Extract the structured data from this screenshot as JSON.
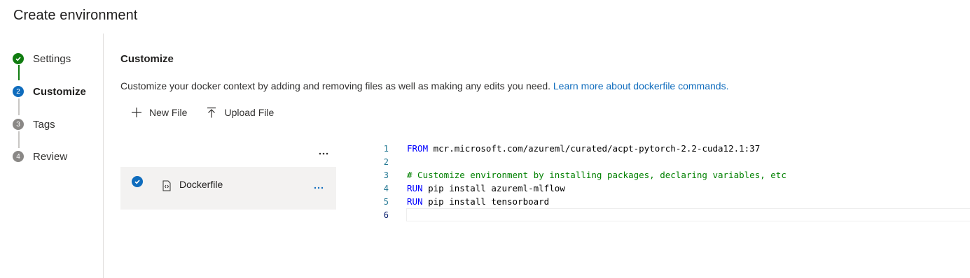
{
  "page": {
    "title": "Create environment"
  },
  "stepper": {
    "steps": [
      {
        "number": "",
        "label": "Settings",
        "state": "completed"
      },
      {
        "number": "2",
        "label": "Customize",
        "state": "active"
      },
      {
        "number": "3",
        "label": "Tags",
        "state": "pending"
      },
      {
        "number": "4",
        "label": "Review",
        "state": "pending"
      }
    ]
  },
  "main": {
    "title": "Customize",
    "description": "Customize your docker context by adding and removing files as well as making any edits you need.",
    "learn_more_link": "Learn more about dockerfile commands.",
    "toolbar": {
      "new_file_label": "New File",
      "upload_file_label": "Upload File"
    },
    "file_panel": {
      "more_label": "...",
      "files": [
        {
          "name": "Dockerfile",
          "selected": true,
          "more_label": "..."
        }
      ]
    }
  },
  "editor": {
    "lines": [
      {
        "number": "1",
        "keyword": "FROM",
        "rest": " mcr.microsoft.com/azureml/curated/acpt-pytorch-2.2-cuda12.1:37",
        "comment": ""
      },
      {
        "number": "2",
        "keyword": "",
        "rest": "",
        "comment": ""
      },
      {
        "number": "3",
        "keyword": "",
        "rest": "",
        "comment": "# Customize environment by installing packages, declaring variables, etc"
      },
      {
        "number": "4",
        "keyword": "RUN",
        "rest": " pip install azureml-mlflow",
        "comment": ""
      },
      {
        "number": "5",
        "keyword": "RUN",
        "rest": " pip install tensorboard",
        "comment": ""
      },
      {
        "number": "6",
        "keyword": "",
        "rest": "",
        "comment": ""
      }
    ],
    "current_line": "6"
  },
  "colors": {
    "accent": "#0f6cbd",
    "success": "#107c10",
    "keyword": "#0000ff",
    "comment": "#008000"
  }
}
